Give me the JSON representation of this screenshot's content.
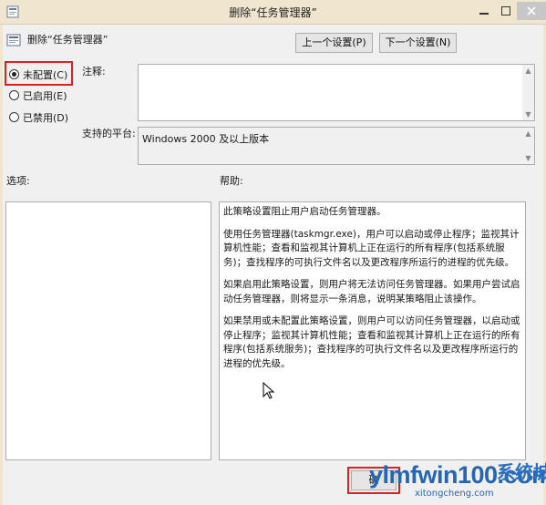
{
  "window": {
    "title": "删除“任务管理器”",
    "minimize_icon": "minimize-icon",
    "maximize_icon": "maximize-icon",
    "close_icon": "close-icon"
  },
  "policy": {
    "name": "删除“任务管理器”",
    "icon": "policy-setting-icon"
  },
  "nav": {
    "prev_label": "上一个设置(P)",
    "next_label": "下一个设置(N)"
  },
  "state": {
    "options": [
      {
        "label": "未配置(C)",
        "selected": true
      },
      {
        "label": "已启用(E)",
        "selected": false
      },
      {
        "label": "已禁用(D)",
        "selected": false
      }
    ],
    "highlight_color": "#e02020"
  },
  "comment": {
    "label": "注释:",
    "value": ""
  },
  "platform": {
    "label": "支持的平台:",
    "value": "Windows 2000 及以上版本"
  },
  "options_panel": {
    "label": "选项:"
  },
  "help": {
    "label": "帮助:",
    "paragraphs": [
      "此策略设置阻止用户启动任务管理器。",
      "使用任务管理器(taskmgr.exe)，用户可以启动或停止程序；监视其计算机性能；查看和监视其计算机上正在运行的所有程序(包括系统服务)；查找程序的可执行文件名以及更改程序所运行的进程的优先级。",
      "如果启用此策略设置，则用户将无法访问任务管理器。如果用户尝试启动任务管理器，则将显示一条消息，说明某策略阻止该操作。",
      "如果禁用或未配置此策略设置，则用户可以访问任务管理器，以启动或停止程序；监视其计算机性能；查看和监视其计算机上正在运行的所有程序(包括系统服务)；查找程序的可执行文件名以及更改程序所运行的进程的优先级。"
    ]
  },
  "footer": {
    "ok_label": "确"
  },
  "watermark": {
    "text": "ylmfwin100.com",
    "cn": "系统城",
    "sub": "xitongcheng.com"
  }
}
